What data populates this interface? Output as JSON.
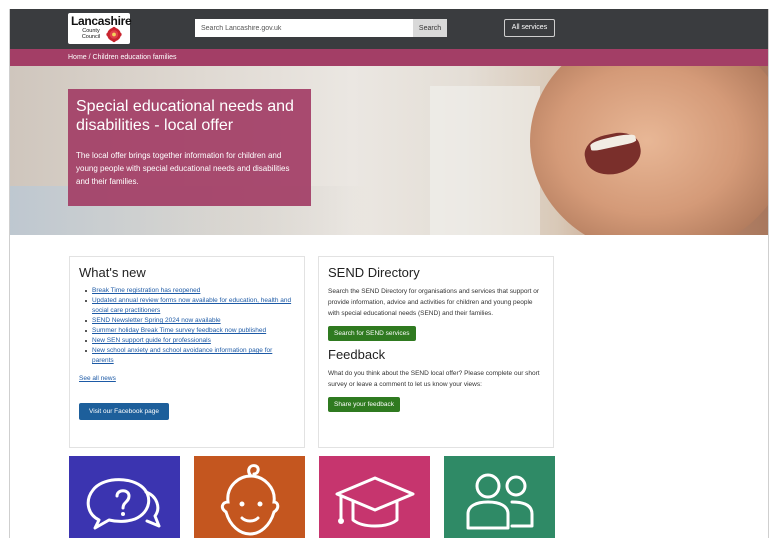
{
  "header": {
    "logo_text": "Lancashire",
    "logo_sub": "County Council",
    "search_placeholder": "Search Lancashire.gov.uk",
    "search_button": "Search",
    "all_services": "All services"
  },
  "breadcrumb": "Home / Children education families",
  "hero": {
    "title": "Special educational needs and disabilities - local offer",
    "text": "The local offer brings together information for children and young people with special educational needs and disabilities and their families."
  },
  "whats_new": {
    "heading": "What's new",
    "items": [
      "Break Time registration has reopened",
      "Updated annual review forms now available for education, health and social care practitioners",
      "SEND Newsletter Spring 2024 now available",
      "Summer holiday Break Time survey feedback now published",
      "New SEN support guide for professionals",
      "New school anxiety and school avoidance information page for parents"
    ],
    "see_all": "See all news",
    "facebook_button": "Visit our Facebook page"
  },
  "send_directory": {
    "heading": "SEND Directory",
    "text": "Search the SEND Directory for organisations and services that support or provide information, advice and activities for children and young people with special educational needs (SEND) and their families.",
    "button": "Search for SEND services"
  },
  "feedback": {
    "heading": "Feedback",
    "text": "What do you think about the SEND local offer? Please complete our short survey or leave a comment to let us know your views:",
    "button": "Share your feedback"
  },
  "colors": {
    "header": "#3a3c3f",
    "brand": "#a33e66",
    "tile_help": "#3b34b0",
    "tile_early_years": "#c4561f",
    "tile_education": "#c6356e",
    "tile_family": "#2f8a66"
  },
  "tiles": [
    {
      "icon": "question-speech-icon"
    },
    {
      "icon": "baby-face-icon"
    },
    {
      "icon": "graduation-cap-icon"
    },
    {
      "icon": "people-icon"
    }
  ]
}
